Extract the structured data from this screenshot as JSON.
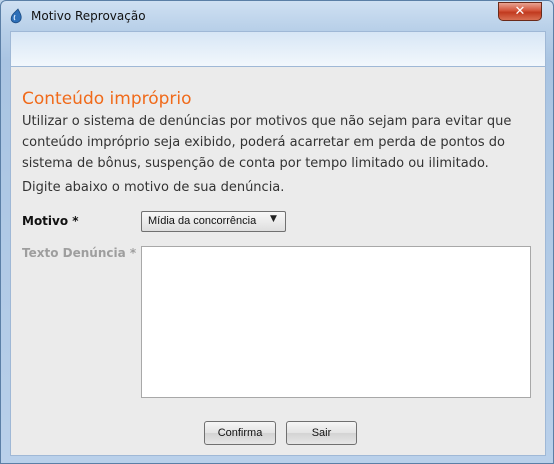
{
  "window": {
    "title": "Motivo Reprovação",
    "close_label": "✕"
  },
  "content": {
    "heading": "Conteúdo impróprio",
    "description": "Utilizar o sistema de denúncias por motivos que não sejam para evitar que conteúdo impróprio seja exibido, poderá acarretar em perda de pontos do sistema de bônus, suspenção de conta por tempo limitado ou ilimitado.",
    "hint": "Digite abaixo o motivo de sua denúncia."
  },
  "form": {
    "motivo_label": "Motivo *",
    "motivo_selected": "Mídia da concorrência",
    "texto_label": "Texto Denúncia *",
    "texto_value": ""
  },
  "buttons": {
    "confirm_label": "Confirma",
    "exit_label": "Sair"
  },
  "colors": {
    "heading": "#f06a1a",
    "disabled_label": "#9e9e9e",
    "client_bg": "#ebebeb"
  }
}
